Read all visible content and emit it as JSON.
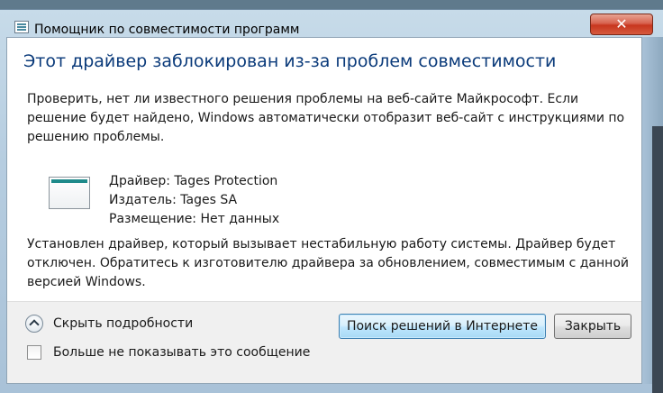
{
  "window": {
    "title": "Помощник по совместимости программ",
    "close_glyph": "✕"
  },
  "content": {
    "headline": "Этот драйвер заблокирован из-за проблем совместимости",
    "intro": "Проверить, нет ли известного решения проблемы на веб-сайте Майкрософт. Если решение будет найдено, Windows автоматически отобразит веб-сайт с инструкциями по решению проблемы.",
    "driver_line": "Драйвер: Tages Protection",
    "publisher_line": "Издатель: Tages SA",
    "location_line": "Размещение: Нет данных",
    "warning": "Установлен драйвер, который вызывает нестабильную работу системы. Драйвер будет отключен. Обратитесь к изготовителю драйвера за обновлением, совместимым с данной версией Windows."
  },
  "footer": {
    "toggle_label": "Скрыть подробности",
    "checkbox_label": "Больше не показывать это сообщение",
    "search_button": "Поиск решений в Интернете",
    "close_button": "Закрыть"
  },
  "colors": {
    "headline": "#0a3a7a",
    "primary_button_border": "#3c7fb1",
    "close_button_red": "#c7361e"
  }
}
